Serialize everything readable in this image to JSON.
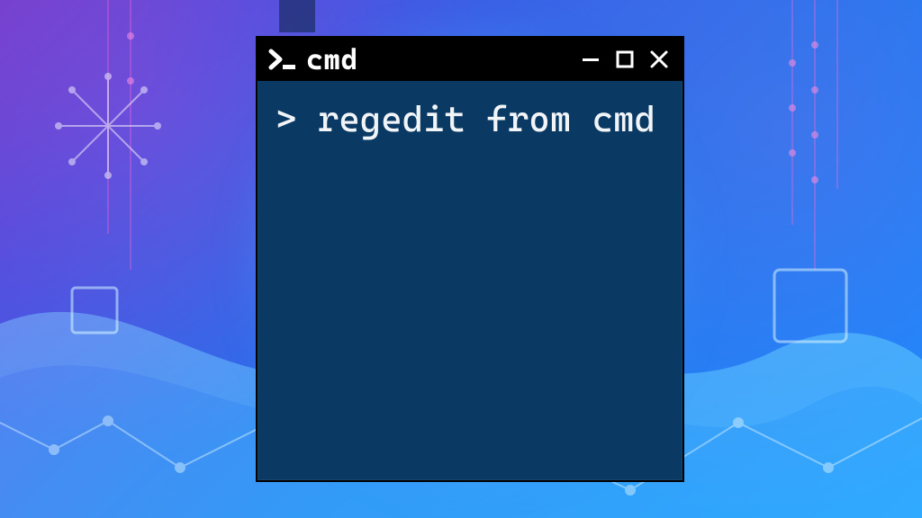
{
  "window": {
    "title": "cmd",
    "icons": {
      "app": "terminal-icon",
      "minimize": "minimize-icon",
      "maximize": "maximize-icon",
      "close": "close-icon"
    }
  },
  "terminal": {
    "prompt": ">",
    "command": "regedit from cmd"
  },
  "colors": {
    "terminal_bg": "#0a3a63",
    "titlebar_bg": "#000000",
    "text": "#f2f5f8"
  }
}
